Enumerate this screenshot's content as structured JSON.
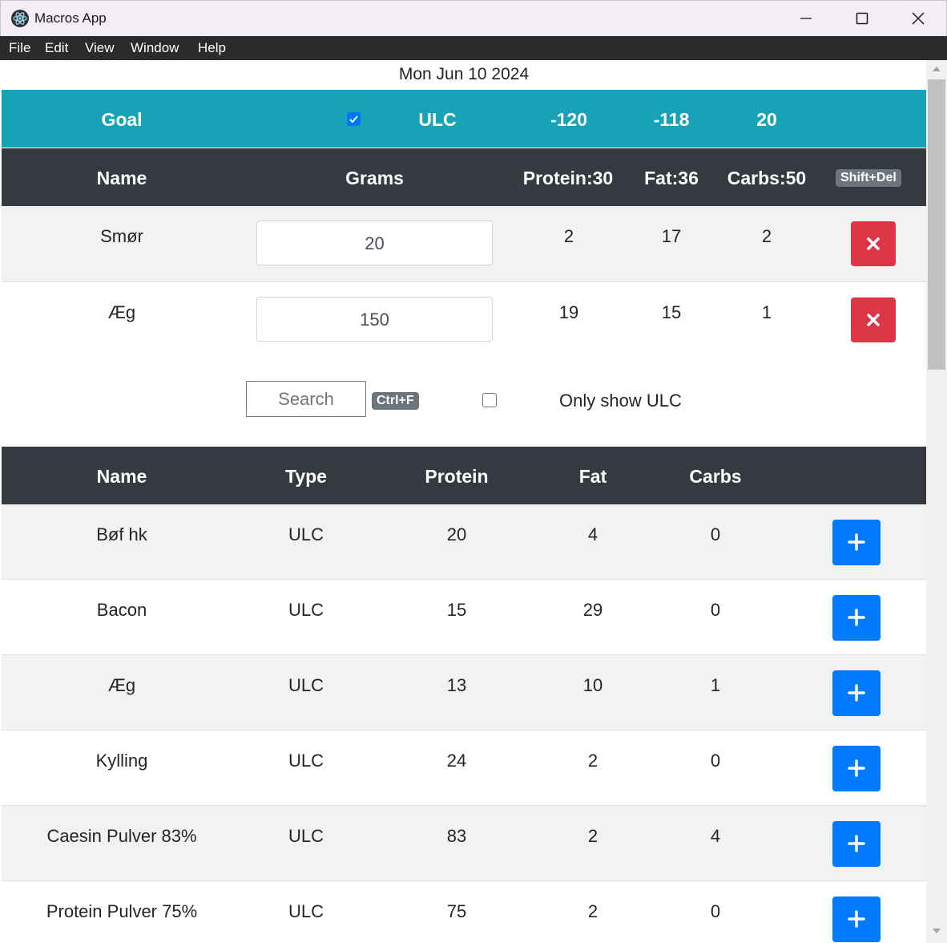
{
  "window": {
    "title": "Macros App"
  },
  "menu": [
    "File",
    "Edit",
    "View",
    "Window",
    "Help"
  ],
  "date": "Mon Jun 10 2024",
  "goal": {
    "label": "Goal",
    "checked": true,
    "type": "ULC",
    "protein": "-120",
    "fat": "-118",
    "carbs": "20"
  },
  "selected_header": {
    "name": "Name",
    "grams": "Grams",
    "protein": "Protein:30",
    "fat": "Fat:36",
    "carbs": "Carbs:50",
    "shortcut": "Shift+Del"
  },
  "selected_items": [
    {
      "name": "Smør",
      "grams": "20",
      "protein": "2",
      "fat": "17",
      "carbs": "2"
    },
    {
      "name": "Æg",
      "grams": "150",
      "protein": "19",
      "fat": "15",
      "carbs": "1"
    }
  ],
  "search": {
    "placeholder": "Search",
    "shortcut": "Ctrl+F",
    "only_ulc_checked": false,
    "only_ulc_label": "Only show ULC"
  },
  "food_header": {
    "name": "Name",
    "type": "Type",
    "protein": "Protein",
    "fat": "Fat",
    "carbs": "Carbs"
  },
  "foods": [
    {
      "name": "Bøf hk",
      "type": "ULC",
      "protein": "20",
      "fat": "4",
      "carbs": "0"
    },
    {
      "name": "Bacon",
      "type": "ULC",
      "protein": "15",
      "fat": "29",
      "carbs": "0"
    },
    {
      "name": "Æg",
      "type": "ULC",
      "protein": "13",
      "fat": "10",
      "carbs": "1"
    },
    {
      "name": "Kylling",
      "type": "ULC",
      "protein": "24",
      "fat": "2",
      "carbs": "0"
    },
    {
      "name": "Caesin Pulver 83%",
      "type": "ULC",
      "protein": "83",
      "fat": "2",
      "carbs": "4"
    },
    {
      "name": "Protein Pulver 75%",
      "type": "ULC",
      "protein": "75",
      "fat": "2",
      "carbs": "0"
    }
  ],
  "colors": {
    "goal_bg": "#17a2b8",
    "header_bg": "#343a40",
    "delete_btn": "#dc3545",
    "add_btn": "#007bff"
  },
  "icons": {
    "app": "electron-atom-icon",
    "delete": "times-icon",
    "add": "plus-icon"
  }
}
